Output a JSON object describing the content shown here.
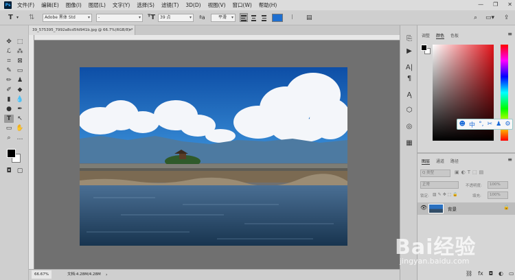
{
  "menu": [
    "文件(F)",
    "编辑(E)",
    "图像(I)",
    "图层(L)",
    "文字(Y)",
    "选择(S)",
    "滤镜(T)",
    "3D(D)",
    "视图(V)",
    "窗口(W)",
    "帮助(H)"
  ],
  "app_logo": "Ps",
  "options": {
    "font_family": "Adobe 黑体 Std",
    "font_style": "-",
    "font_size": "39 点",
    "anti_alias": "平滑",
    "color_swatch": "#1e6fd0"
  },
  "document": {
    "tab_title": "39_575395_7992a8cd5fd941b.jpg @ 66.7%(RGB/8) *",
    "zoom": "66.67%",
    "doc_info": "文档:4.28M/4.28M"
  },
  "color_panel": {
    "tabs": [
      "调整",
      "颜色",
      "色板"
    ],
    "active_tab": "颜色"
  },
  "ime_bar": {
    "items": [
      "中",
      "°,",
      "✂",
      "♟",
      "⚙"
    ]
  },
  "layers_panel": {
    "tabs": [
      "图层",
      "通道",
      "路径"
    ],
    "filter_placeholder": "Q 类型",
    "blend_mode": "正常",
    "opacity_label": "不透明度:",
    "opacity_value": "100%",
    "lock_label": "锁定:",
    "fill_label": "填充:",
    "fill_value": "100%",
    "layers": [
      {
        "name": "背景",
        "visible": true,
        "locked": true
      }
    ]
  },
  "watermark": {
    "brand": "Bai经验",
    "url": "jingyan.baidu.com"
  }
}
